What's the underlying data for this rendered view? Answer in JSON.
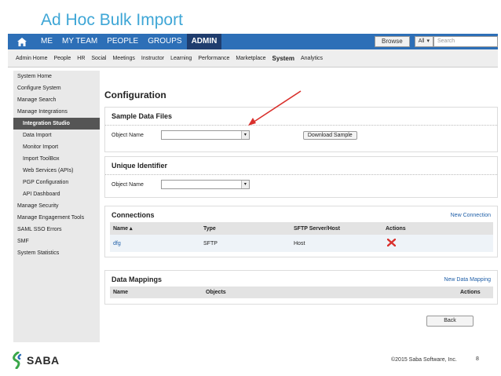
{
  "slide": {
    "title": "Ad Hoc Bulk Import",
    "copyright": "©2015 Saba Software, Inc.",
    "page_number": "8",
    "logo_text": "SABA"
  },
  "topnav": {
    "tabs": [
      "ME",
      "MY TEAM",
      "PEOPLE",
      "GROUPS",
      "ADMIN"
    ],
    "active": "ADMIN",
    "browse_label": "Browse",
    "all_label": "All",
    "search_placeholder": "Search"
  },
  "subnav": {
    "items": [
      "Admin Home",
      "People",
      "HR",
      "Social",
      "Meetings",
      "Instructor",
      "Learning",
      "Performance",
      "Marketplace",
      "System",
      "Analytics"
    ],
    "active": "System"
  },
  "sidebar": {
    "items": [
      {
        "label": "System Home",
        "sub": false,
        "active": false
      },
      {
        "label": "Configure System",
        "sub": false,
        "active": false
      },
      {
        "label": "Manage Search",
        "sub": false,
        "active": false
      },
      {
        "label": "Manage Integrations",
        "sub": false,
        "active": false
      },
      {
        "label": "Integration Studio",
        "sub": true,
        "active": true
      },
      {
        "label": "Data Import",
        "sub": true,
        "active": false
      },
      {
        "label": "Monitor Import",
        "sub": true,
        "active": false
      },
      {
        "label": "Import ToolBox",
        "sub": true,
        "active": false
      },
      {
        "label": "Web Services (APIs)",
        "sub": true,
        "active": false
      },
      {
        "label": "PGP Configuration",
        "sub": true,
        "active": false
      },
      {
        "label": "API Dashboard",
        "sub": true,
        "active": false
      },
      {
        "label": "Manage Security",
        "sub": false,
        "active": false
      },
      {
        "label": "Manage Engagement Tools",
        "sub": false,
        "active": false
      },
      {
        "label": "SAML SSO Errors",
        "sub": false,
        "active": false
      },
      {
        "label": "SMF",
        "sub": false,
        "active": false
      },
      {
        "label": "System Statistics",
        "sub": false,
        "active": false
      }
    ]
  },
  "main": {
    "title": "Configuration",
    "sample": {
      "title": "Sample Data Files",
      "field_label": "Object Name",
      "button": "Download Sample"
    },
    "unique": {
      "title": "Unique Identifier",
      "field_label": "Object Name"
    },
    "connections": {
      "title": "Connections",
      "new_link": "New Connection",
      "headers": [
        "Name ▴",
        "Type",
        "SFTP Server/Host",
        "Actions"
      ],
      "rows": [
        {
          "name": "dfg",
          "type": "SFTP",
          "host": "Host"
        }
      ]
    },
    "mappings": {
      "title": "Data Mappings",
      "new_link": "New Data Mapping",
      "headers": [
        "Name",
        "Objects",
        "Actions"
      ]
    },
    "back_button": "Back"
  },
  "colors": {
    "nav_blue": "#2d6fb7",
    "title_blue": "#3ea6d6",
    "link_blue": "#1f5fa8",
    "delete_red": "#d9302c",
    "annotation_red": "#d9302c"
  }
}
